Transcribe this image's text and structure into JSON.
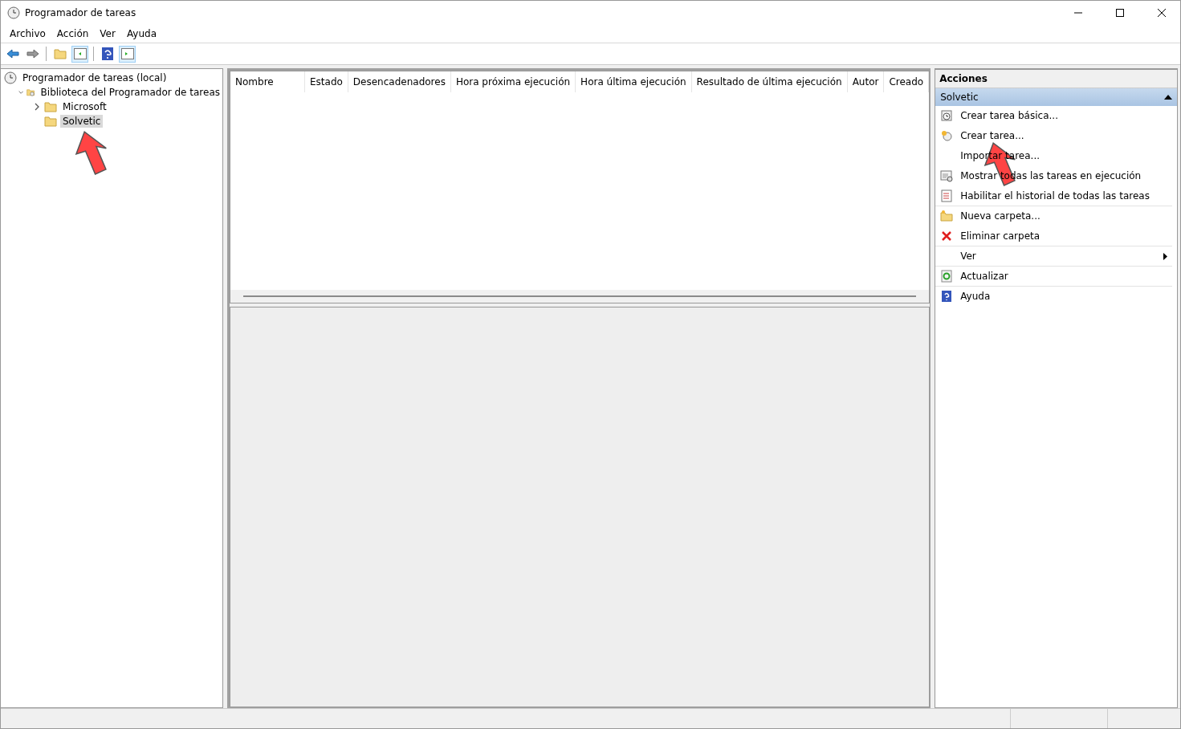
{
  "window": {
    "title": "Programador de tareas"
  },
  "menu": [
    "Archivo",
    "Acción",
    "Ver",
    "Ayuda"
  ],
  "tree": [
    {
      "label": "Programador de tareas (local)",
      "selected": false,
      "children": [
        {
          "label": "Biblioteca del Programador de tareas",
          "expanded": true,
          "selected": false,
          "children": [
            {
              "label": "Microsoft",
              "expanded": false,
              "selected": false
            },
            {
              "label": "Solvetic",
              "selected": true
            }
          ]
        }
      ]
    }
  ],
  "table": {
    "columns": [
      "Nombre",
      "Estado",
      "Desencadenadores",
      "Hora próxima ejecución",
      "Hora última ejecución",
      "Resultado de última ejecución",
      "Autor",
      "Creado"
    ]
  },
  "actions": {
    "title": "Acciones",
    "section": {
      "label": "Solvetic",
      "expanded": true
    },
    "items": [
      {
        "label": "Crear tarea básica...",
        "divider_below": false,
        "submenu": false
      },
      {
        "label": "Crear tarea...",
        "divider_below": false,
        "submenu": false
      },
      {
        "label": "Importar tarea...",
        "divider_below": false,
        "submenu": false
      },
      {
        "label": "Mostrar todas las tareas en ejecución",
        "divider_below": false,
        "submenu": false
      },
      {
        "label": "Habilitar el historial de todas las tareas",
        "divider_below": true,
        "submenu": false
      },
      {
        "label": "Nueva carpeta...",
        "divider_below": false,
        "submenu": false
      },
      {
        "label": "Eliminar carpeta",
        "divider_below": true,
        "submenu": false
      },
      {
        "label": "Ver",
        "divider_below": true,
        "submenu": true
      },
      {
        "label": "Actualizar",
        "divider_below": true,
        "submenu": false
      },
      {
        "label": "Ayuda",
        "divider_below": false,
        "submenu": false
      }
    ]
  }
}
